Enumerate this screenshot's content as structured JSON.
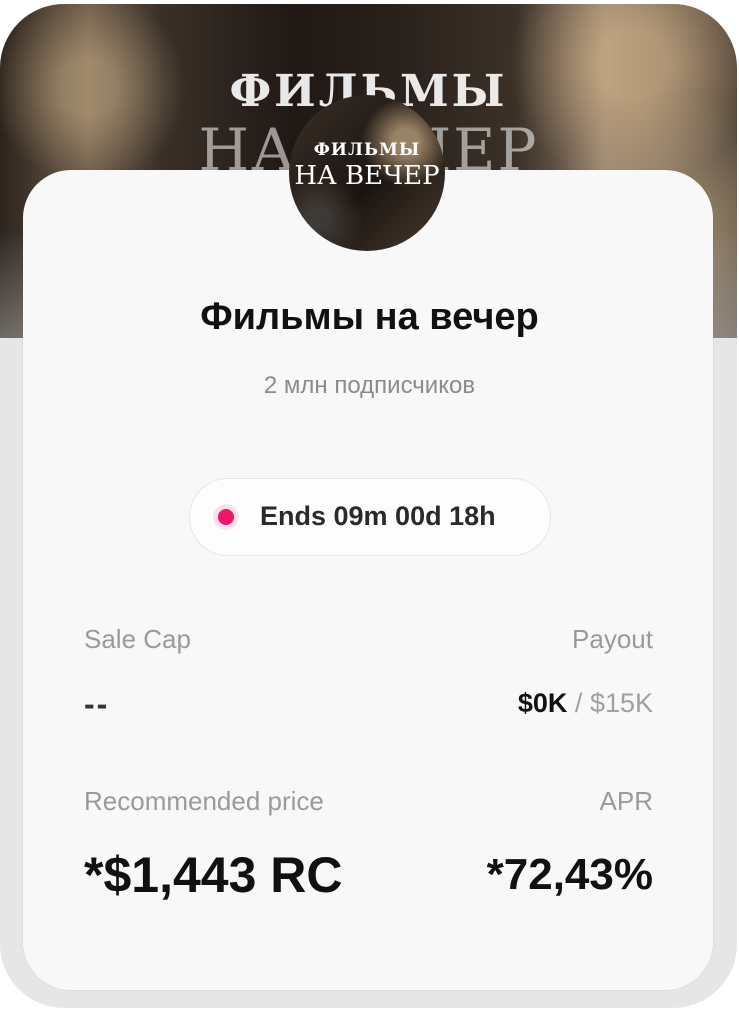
{
  "banner": {
    "title": "ФИЛЬМЫ",
    "subtitle": "НА ВЕЧЕР"
  },
  "avatar": {
    "line1": "ФИЛЬМЫ",
    "line2": "НА ВЕЧЕР"
  },
  "channel": {
    "title": "Фильмы на вечер",
    "subscribers": "2 млн подписчиков"
  },
  "status": {
    "ends_text": "Ends 09m 00d 18h",
    "dot_color": "#ef1567"
  },
  "stats": {
    "sale_cap_label": "Sale Cap",
    "sale_cap_value": "--",
    "payout_label": "Payout",
    "payout_current": "$0K",
    "payout_separator": "/",
    "payout_total": "$15K",
    "recommended_price_label": "Recommended price",
    "recommended_price_value": "*$1,443 RC",
    "apr_label": "APR",
    "apr_value": "*72,43%"
  }
}
